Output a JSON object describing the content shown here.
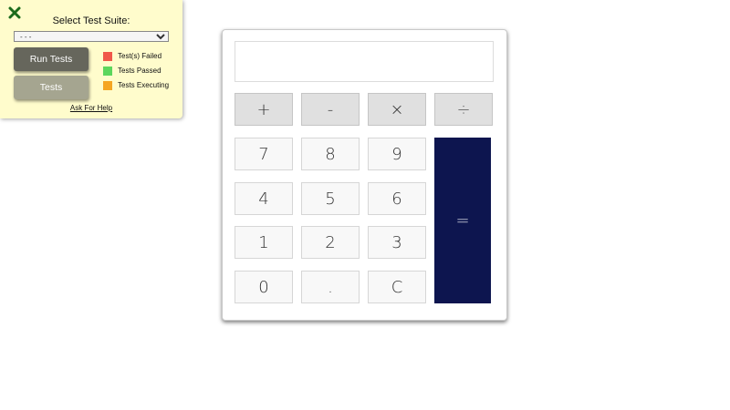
{
  "test_panel": {
    "title": "Select Test Suite:",
    "select_value": "- - -",
    "run_tests_label": "Run Tests",
    "tests_label": "Tests",
    "legend": [
      {
        "label": "Test(s) Failed",
        "color": "#f0584a"
      },
      {
        "label": "Tests Passed",
        "color": "#5cd65c"
      },
      {
        "label": "Tests Executing",
        "color": "#f5a623"
      }
    ],
    "help_link": "Ask For Help",
    "close_icon": "close-x-icon",
    "close_color": "#1b6b1b"
  },
  "calculator": {
    "display_value": "",
    "operators": {
      "add": "+",
      "subtract": "-",
      "multiply": "×",
      "divide": "÷"
    },
    "digits": {
      "n7": "7",
      "n8": "8",
      "n9": "9",
      "n4": "4",
      "n5": "5",
      "n6": "6",
      "n1": "1",
      "n2": "2",
      "n3": "3",
      "n0": "0"
    },
    "decimal": ".",
    "clear": "C",
    "equals": "=",
    "equals_color": "#0d154f"
  }
}
